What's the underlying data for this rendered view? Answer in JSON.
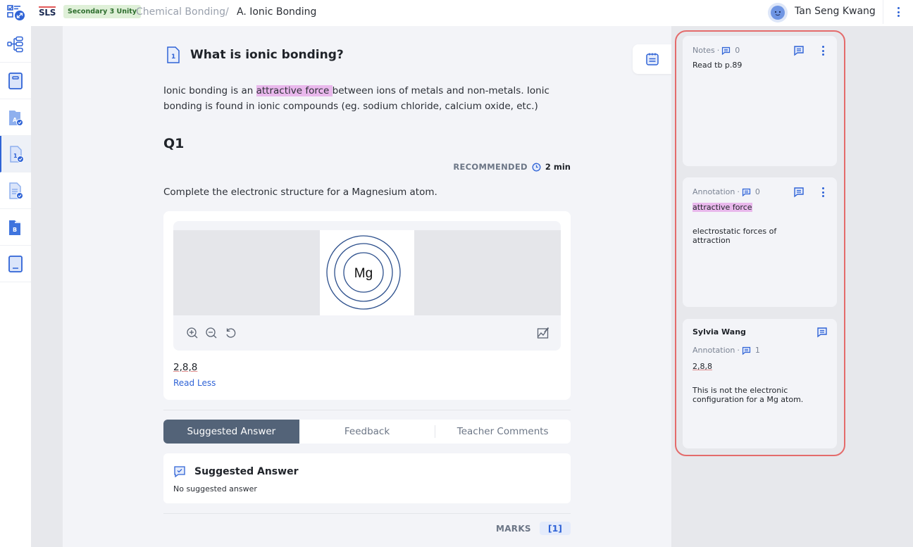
{
  "header": {
    "logo": "SLS",
    "class_badge": "Secondary 3 Unity",
    "breadcrumb": [
      "Chemical Bonding",
      "A. Ionic Bonding"
    ],
    "breadcrumb_separator": "/",
    "user_name": "Tan Seng Kwang"
  },
  "sidebar": {
    "items": [
      {
        "icon": "lesson-map-icon",
        "active": false
      },
      {
        "icon": "notebook-icon",
        "active": false
      },
      {
        "icon": "section-a-folder-icon",
        "active": false
      },
      {
        "icon": "page-1-icon",
        "active": true
      },
      {
        "icon": "document-check-icon",
        "active": false
      },
      {
        "icon": "section-b-folder-icon",
        "active": false
      },
      {
        "icon": "book-icon",
        "active": false
      }
    ]
  },
  "main": {
    "page_number": "1",
    "title": "What is ionic bonding?",
    "intro_before": "Ionic bonding is an ",
    "intro_highlight": "attractive force ",
    "intro_after": "between ions of metals and non-metals. Ionic bonding is found in ionic compounds (eg. sodium chloride, calcium oxide, etc.)",
    "question_label": "Q1",
    "recommended_label": "RECOMMENDED",
    "recommended_time": "2 min",
    "prompt": "Complete the electronic structure for a Magnesium atom.",
    "diagram_label": "Mg",
    "student_answer": "2,8,8",
    "read_less": "Read Less",
    "tabs": [
      {
        "label": "Suggested Answer",
        "active": true
      },
      {
        "label": "Feedback",
        "active": false
      },
      {
        "label": "Teacher Comments",
        "active": false
      }
    ],
    "suggested_answer": {
      "title": "Suggested Answer",
      "body": "No suggested answer"
    },
    "marks_label": "MARKS",
    "marks_value": "[1]"
  },
  "notes_panel": {
    "cards": [
      {
        "type": "Notes",
        "separator": "·",
        "comment_count": "0",
        "author": null,
        "highlight": null,
        "text": "Read tb p.89"
      },
      {
        "type": "Annotation",
        "separator": "·",
        "comment_count": "0",
        "author": null,
        "highlight": "attractive force",
        "text": "electrostatic forces of attraction"
      },
      {
        "type": "Annotation",
        "separator": "·",
        "comment_count": "1",
        "author": "Sylvia Wang",
        "highlight": "2,8,8",
        "text": "This is not the electronic configuration for a Mg atom."
      }
    ]
  },
  "colors": {
    "accent": "#2f63d6",
    "highlight": "#e9b8ec",
    "active_tab": "#536378",
    "outline": "#e46b6b",
    "badge_bg": "#dff0d8"
  }
}
